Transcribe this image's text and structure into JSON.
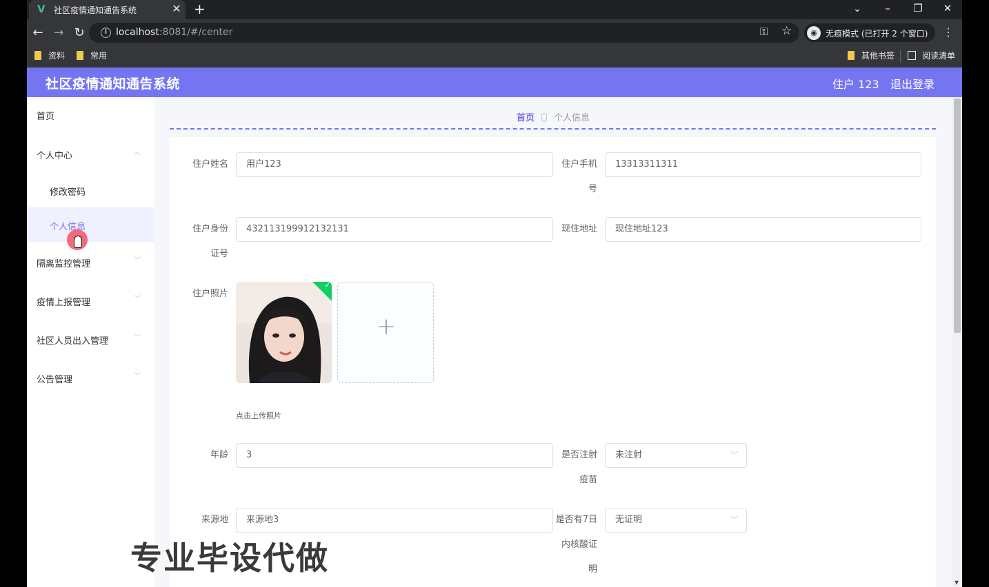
{
  "browser": {
    "tab_title": "社区疫情通知通告系统",
    "tab_favicon": "V",
    "tab_close": "✕",
    "new_tab": "+",
    "url_host": "localhost",
    "url_rest": ":8081/#/center",
    "incognito_label": "无痕模式 (已打开 2 个窗口)",
    "bookmarks": [
      "资料",
      "常用"
    ],
    "other_bookmarks": "其他书签",
    "reading_list": "阅读清单"
  },
  "header": {
    "title": "社区疫情通知通告系统",
    "user": "住户 123",
    "logout": "退出登录"
  },
  "sidebar": {
    "items": [
      {
        "label": "首页"
      },
      {
        "label": "个人中心"
      },
      {
        "label": "修改密码"
      },
      {
        "label": "个人信息"
      },
      {
        "label": "隔离监控管理"
      },
      {
        "label": "疫情上报管理"
      },
      {
        "label": "社区人员出入管理"
      },
      {
        "label": "公告管理"
      }
    ]
  },
  "breadcrumb": {
    "home": "首页",
    "current": "个人信息"
  },
  "form": {
    "name_label": "住户姓名",
    "name_value": "用户123",
    "phone_label_1": "住户手机",
    "phone_label_2": "号",
    "phone_value": "13313311311",
    "id_label_1": "住户身份",
    "id_label_2": "证号",
    "id_value": "432113199912132131",
    "address_label": "现住地址",
    "address_value": "现住地址123",
    "photo_label": "住户照片",
    "upload_tip": "点击上传照片",
    "age_label": "年龄",
    "age_value": "3",
    "vaccine_label_1": "是否注射",
    "vaccine_label_2": "疫苗",
    "vaccine_value": "未注射",
    "origin_label": "来源地",
    "origin_value": "来源地3",
    "nucleic_label_1": "是否有7日",
    "nucleic_label_2": "内核酸证",
    "nucleic_label_3": "明",
    "nucleic_value": "无证明"
  },
  "overlay": {
    "watermark": "专业毕设代做"
  },
  "colors": {
    "accent": "#7575f2",
    "success": "#13ce66"
  }
}
